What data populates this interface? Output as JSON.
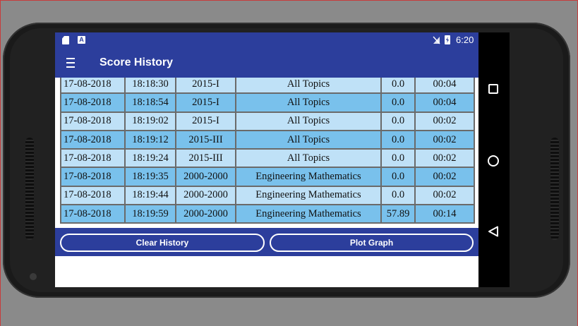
{
  "status_bar": {
    "time": "6:20",
    "icons": [
      "sd-card-icon",
      "a-notification-icon",
      "no-sim-icon",
      "battery-charging-icon"
    ],
    "a_icon_glyph": "A"
  },
  "app_bar": {
    "title": "Score History",
    "menu_icon": "hamburger-menu-icon"
  },
  "colors": {
    "primary": "#2c3e9c",
    "row_light": "#bfe1f7",
    "row_dark": "#79c1ec",
    "grid": "#6a6a6a"
  },
  "history": {
    "rows": [
      [
        "17-08-2018",
        "18:18:30",
        "2015-I",
        "All Topics",
        "0.0",
        "00:04"
      ],
      [
        "17-08-2018",
        "18:18:54",
        "2015-I",
        "All Topics",
        "0.0",
        "00:04"
      ],
      [
        "17-08-2018",
        "18:19:02",
        "2015-I",
        "All Topics",
        "0.0",
        "00:02"
      ],
      [
        "17-08-2018",
        "18:19:12",
        "2015-III",
        "All Topics",
        "0.0",
        "00:02"
      ],
      [
        "17-08-2018",
        "18:19:24",
        "2015-III",
        "All Topics",
        "0.0",
        "00:02"
      ],
      [
        "17-08-2018",
        "18:19:35",
        "2000-2000",
        "Engineering Mathematics",
        "0.0",
        "00:02"
      ],
      [
        "17-08-2018",
        "18:19:44",
        "2000-2000",
        "Engineering Mathematics",
        "0.0",
        "00:02"
      ],
      [
        "17-08-2018",
        "18:19:59",
        "2000-2000",
        "Engineering Mathematics",
        "57.89",
        "00:14"
      ]
    ]
  },
  "actions": {
    "clear_label": "Clear History",
    "plot_label": "Plot Graph"
  },
  "nav_bar": {
    "icons": [
      "recents-square-icon",
      "home-circle-icon",
      "back-triangle-icon"
    ]
  }
}
